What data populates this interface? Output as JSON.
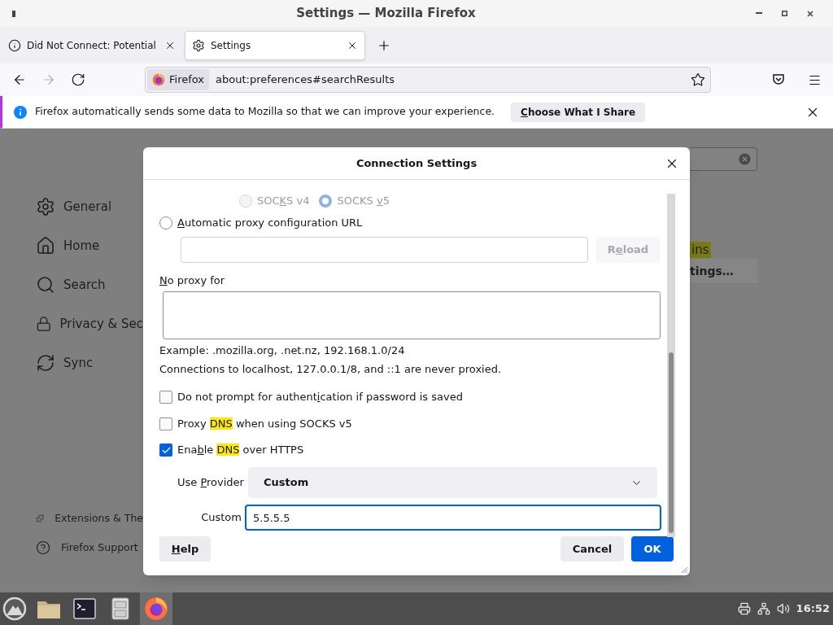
{
  "window": {
    "title": "Settings — Mozilla Firefox"
  },
  "tabs": [
    {
      "label": "Did Not Connect: Potential",
      "selected": false
    },
    {
      "label": "Settings",
      "selected": true
    }
  ],
  "nav_buttons": [
    {
      "kind": "back",
      "disabled": false
    },
    {
      "kind": "forward",
      "disabled": true
    },
    {
      "kind": "reload",
      "disabled": false
    }
  ],
  "url_bar": {
    "identity": "Firefox",
    "value": "about:preferences#searchResults"
  },
  "notification": {
    "message": "Firefox automatically sends some data to Mozilla so that we can improve your experience.",
    "button": [
      {
        "text": "C",
        "kind": "accesskey"
      },
      {
        "text": "hoose What I Share",
        "kind": "plain"
      }
    ]
  },
  "settings_page": {
    "sidebar": [
      {
        "kind": "general",
        "label": "General"
      },
      {
        "kind": "home",
        "label": "Home"
      },
      {
        "kind": "search",
        "label": "Search"
      },
      {
        "kind": "privacy",
        "label": "Privacy & Sec"
      },
      {
        "kind": "sync",
        "label": "Sync"
      }
    ],
    "footer": [
      {
        "kind": "extensions",
        "label": "Extensions & The"
      },
      {
        "kind": "support",
        "label": "Firefox Support"
      }
    ],
    "result_highlight": "ins",
    "result_button": "tings…"
  },
  "dialog": {
    "title": "Connection Settings",
    "socks": [
      {
        "label": [
          {
            "text": "SOC",
            "kind": "plain"
          },
          {
            "text": "K",
            "kind": "accesskey"
          },
          {
            "text": "S v4",
            "kind": "plain"
          }
        ],
        "selected": false,
        "disabled": true
      },
      {
        "label": [
          {
            "text": "SOCKS ",
            "kind": "plain"
          },
          {
            "text": "v",
            "kind": "accesskey"
          },
          {
            "text": "5",
            "kind": "plain"
          }
        ],
        "selected": true,
        "disabled": true
      }
    ],
    "auto_proxy": {
      "label": [
        {
          "text": "A",
          "kind": "accesskey"
        },
        {
          "text": "utomatic proxy configuration URL",
          "kind": "plain"
        }
      ],
      "selected": false
    },
    "reload": {
      "label": [
        {
          "text": "R",
          "kind": "plain"
        },
        {
          "text": "e",
          "kind": "accesskey"
        },
        {
          "text": "load",
          "kind": "plain"
        }
      ],
      "disabled": true
    },
    "no_proxy": {
      "label": [
        {
          "text": "N",
          "kind": "accesskey"
        },
        {
          "text": "o proxy for",
          "kind": "plain"
        }
      ]
    },
    "notes": [
      "Example: .mozilla.org, .net.nz, 192.168.1.0/24",
      "Connections to localhost, 127.0.0.1/8, and ::1 are never proxied."
    ],
    "checkboxes": [
      {
        "label": [
          {
            "text": "Do not prompt for authent",
            "kind": "plain"
          },
          {
            "text": "i",
            "kind": "accesskey"
          },
          {
            "text": "cation if password is saved",
            "kind": "plain"
          }
        ],
        "checked": false
      },
      {
        "label": [
          {
            "text": "Proxy ",
            "kind": "plain"
          },
          {
            "text": "DNS",
            "kind": "highlight"
          },
          {
            "text": " when using SOCKS v5",
            "kind": "plain"
          }
        ],
        "checked": false
      },
      {
        "label": [
          {
            "text": "Ena",
            "kind": "plain"
          },
          {
            "text": "b",
            "kind": "accesskey"
          },
          {
            "text": "le ",
            "kind": "plain"
          },
          {
            "text": "DNS",
            "kind": "highlight"
          },
          {
            "text": " over HTTPS",
            "kind": "plain"
          }
        ],
        "checked": true
      }
    ],
    "provider": {
      "label": [
        {
          "text": "Use ",
          "kind": "plain"
        },
        {
          "text": "P",
          "kind": "accesskey"
        },
        {
          "text": "rovider",
          "kind": "plain"
        }
      ],
      "value": "Custom"
    },
    "custom": {
      "label": "Custom",
      "value": "5.5.5.5"
    },
    "buttons": [
      {
        "kind": "help",
        "label": [
          {
            "text": "H",
            "kind": "accesskey"
          },
          {
            "text": "elp",
            "kind": "plain"
          }
        ]
      },
      {
        "kind": "cancel",
        "label": [
          {
            "text": "Cancel",
            "kind": "plain"
          }
        ]
      },
      {
        "kind": "ok",
        "label": [
          {
            "text": "OK",
            "kind": "plain"
          }
        ]
      }
    ]
  },
  "taskbar": {
    "apps": [
      {
        "kind": "launcher",
        "selected": false
      },
      {
        "kind": "files",
        "selected": false
      },
      {
        "kind": "terminal",
        "selected": false
      },
      {
        "kind": "cabinet",
        "selected": false
      },
      {
        "kind": "firefox",
        "selected": true
      }
    ],
    "clock": "16:52"
  }
}
